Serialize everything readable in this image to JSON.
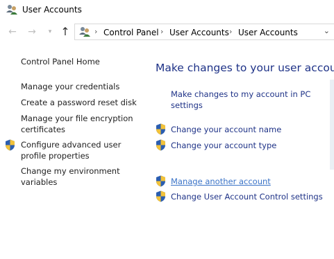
{
  "window": {
    "title": "User Accounts"
  },
  "address_bar": {
    "segments": [
      "Control Panel",
      "User Accounts",
      "User Accounts"
    ]
  },
  "sidebar": {
    "home": "Control Panel Home",
    "items": [
      {
        "label": "Manage your credentials",
        "shield": false
      },
      {
        "label": "Create a password reset disk",
        "shield": false
      },
      {
        "label_lines": [
          "Manage your file encryption",
          "certificates"
        ],
        "shield": false
      },
      {
        "label_lines": [
          "Configure advanced user",
          "profile properties"
        ],
        "shield": true
      },
      {
        "label_lines": [
          "Change my environment",
          "variables"
        ],
        "shield": false
      }
    ]
  },
  "main": {
    "title": "Make changes to your user account",
    "links": [
      {
        "label_lines": [
          "Make changes to my account in PC",
          "settings"
        ],
        "shield": false
      },
      {
        "label": "Change your account name",
        "shield": true
      },
      {
        "label": "Change your account type",
        "shield": true
      },
      {
        "label": "Manage another account",
        "shield": true,
        "hovered": true
      },
      {
        "label": "Change User Account Control settings",
        "shield": true
      }
    ]
  },
  "colors": {
    "link": "#1e3287",
    "hover_link": "#3a73c7",
    "text": "#1e1e1e"
  }
}
